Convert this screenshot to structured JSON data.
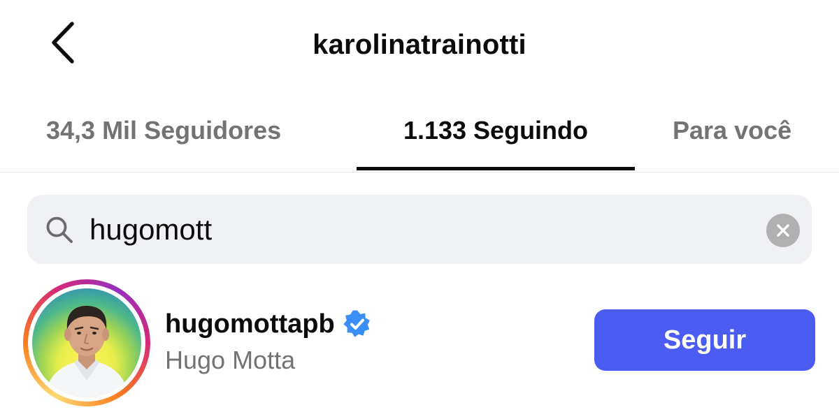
{
  "header": {
    "title": "karolinatrainotti",
    "back_icon": "chevron-left-icon"
  },
  "tabs": [
    {
      "label": "34,3 Mil Seguidores",
      "active": false
    },
    {
      "label": "1.133 Seguindo",
      "active": true
    },
    {
      "label": "Para você",
      "active": false
    }
  ],
  "search": {
    "value": "hugomott",
    "icon": "search-icon",
    "clear_icon": "clear-icon"
  },
  "results": [
    {
      "username": "hugomottapb",
      "full_name": "Hugo Motta",
      "verified": true,
      "has_story_ring": true,
      "follow_label": "Seguir"
    }
  ],
  "colors": {
    "follow_button": "#4a5cf2",
    "verified_badge": "#3a8ef5",
    "secondary_text": "#737373",
    "search_background": "#eff1f4"
  }
}
